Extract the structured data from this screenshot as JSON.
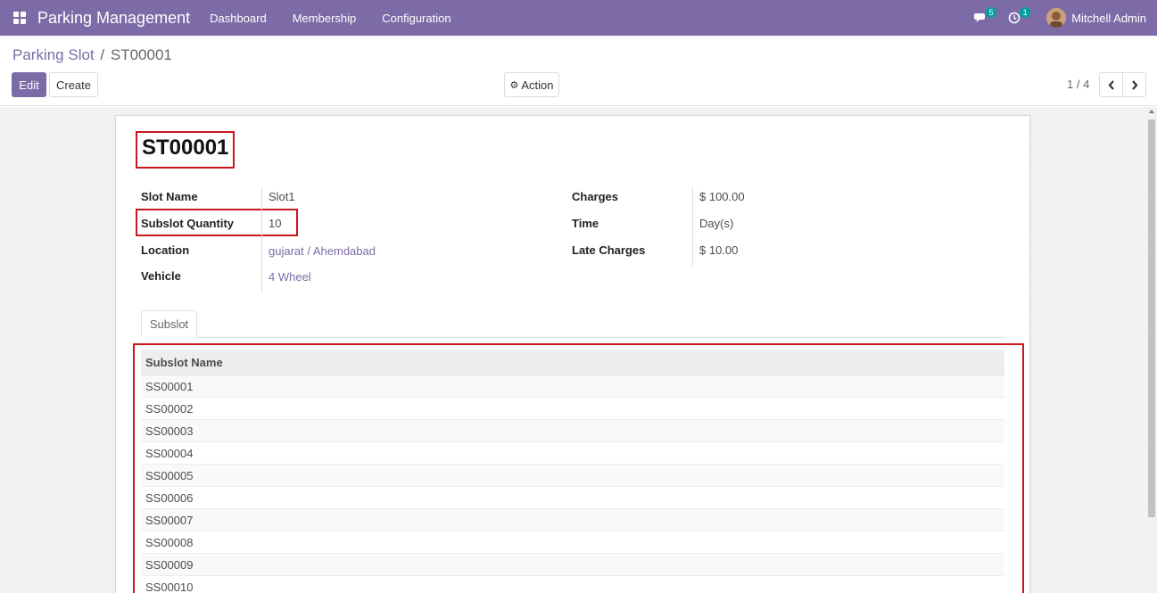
{
  "navbar": {
    "app_title": "Parking Management",
    "menus": [
      "Dashboard",
      "Membership",
      "Configuration"
    ],
    "messages_count": "5",
    "activities_count": "1",
    "user_name": "Mitchell Admin"
  },
  "breadcrumb": {
    "parent": "Parking Slot",
    "separator": "/",
    "current": "ST00001"
  },
  "toolbar": {
    "edit_label": "Edit",
    "create_label": "Create",
    "action_label": "Action",
    "pager": "1 / 4"
  },
  "record": {
    "title": "ST00001",
    "left_fields": [
      {
        "label": "Slot Name",
        "value": "Slot1"
      },
      {
        "label": "Subslot Quantity",
        "value": "10"
      },
      {
        "label": "Location",
        "value": "gujarat / Ahemdabad"
      },
      {
        "label": "Vehicle",
        "value": "4 Wheel"
      }
    ],
    "right_fields": [
      {
        "label": "Charges",
        "value": "$ 100.00"
      },
      {
        "label": "Time",
        "value": "Day(s)"
      },
      {
        "label": "Late Charges",
        "value": "$ 10.00"
      }
    ]
  },
  "tabs": [
    {
      "label": "Subslot"
    }
  ],
  "subslot_table": {
    "header": "Subslot Name",
    "rows": [
      "SS00001",
      "SS00002",
      "SS00003",
      "SS00004",
      "SS00005",
      "SS00006",
      "SS00007",
      "SS00008",
      "SS00009",
      "SS00010"
    ]
  },
  "colors": {
    "brand": "#7c6ba6",
    "highlight": "#c9171e",
    "badge": "#00a09d"
  }
}
